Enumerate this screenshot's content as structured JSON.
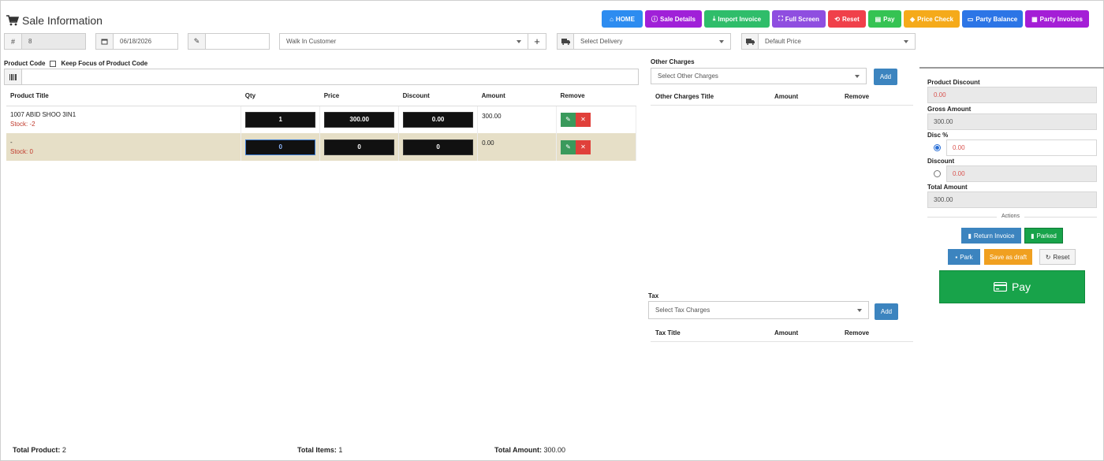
{
  "header": {
    "title": "Sale Information"
  },
  "toolbar": [
    {
      "label": "HOME",
      "icon": "home-icon",
      "color": "#2d8cf0",
      "w": 52
    },
    {
      "label": "Sale Details",
      "icon": "info-icon",
      "color": "#a020d8",
      "w": 72
    },
    {
      "label": "Import Invoice",
      "icon": "download-icon",
      "color": "#2fbd6a",
      "w": 83
    },
    {
      "label": "Full Screen",
      "icon": "fullscreen-icon",
      "color": "#8f4ee0",
      "w": 68
    },
    {
      "label": "Reset",
      "icon": "reset-icon",
      "color": "#f0404a",
      "w": 48
    },
    {
      "label": "Pay",
      "icon": "pay-icon",
      "color": "#35c353",
      "w": 42
    },
    {
      "label": "Price Check",
      "icon": "tag-icon",
      "color": "#f5aa1a",
      "w": 71
    },
    {
      "label": "Party Balance",
      "icon": "wallet-icon",
      "color": "#2c75e6",
      "w": 77
    },
    {
      "label": "Party Invoices",
      "icon": "invoice-icon",
      "color": "#a41ed6",
      "w": 81
    }
  ],
  "form": {
    "invoice_no": "8",
    "date": "06/18/2026",
    "note": "",
    "customer": "Walk In Customer",
    "delivery": "Select Delivery",
    "price_type": "Default Price"
  },
  "product_code": {
    "label": "Product Code",
    "keep_focus_label": "Keep Focus of Product Code",
    "value": ""
  },
  "table": {
    "headers": [
      "Product Title",
      "Qty",
      "Price",
      "Discount",
      "Amount",
      "Remove"
    ],
    "rows": [
      {
        "title": "1007 ABID SHOO 3IN1",
        "stock": "Stock: -2",
        "qty": "1",
        "price": "300.00",
        "discount": "0.00",
        "amount": "300.00"
      },
      {
        "title": "-",
        "stock": "Stock: 0",
        "qty": "0",
        "price": "0",
        "discount": "0",
        "amount": "0.00"
      }
    ]
  },
  "other_charges": {
    "label": "Other Charges",
    "placeholder": "Select Other Charges",
    "add_label": "Add",
    "headers": [
      "Other Charges Title",
      "Amount",
      "Remove"
    ]
  },
  "tax": {
    "label": "Tax",
    "placeholder": "Select Tax Charges",
    "add_label": "Add",
    "headers": [
      "Tax Title",
      "Amount",
      "Remove"
    ]
  },
  "summary": {
    "product_discount_label": "Product Discount",
    "product_discount": "0.00",
    "gross_amount_label": "Gross Amount",
    "gross_amount": "300.00",
    "disc_pct_label": "Disc %",
    "disc_pct": "0.00",
    "discount_label": "Discount",
    "discount": "0.00",
    "total_amount_label": "Total Amount",
    "total_amount": "300.00",
    "actions_label": "Actions"
  },
  "actions": {
    "return_invoice": "Return Invoice",
    "parked": "Parked",
    "park": "Park",
    "save_draft": "Save as draft",
    "reset": "Reset",
    "pay": "Pay"
  },
  "footer": {
    "total_product_label": "Total Product:",
    "total_product": "2",
    "total_items_label": "Total Items:",
    "total_items": "1",
    "total_amount_label": "Total Amount:",
    "total_amount": "300.00"
  },
  "colors": {
    "selected_row": "#e6dfc7",
    "edit_green": "#3a9a5c",
    "remove_red": "#e0403a",
    "pay_green": "#18a34a",
    "save_orange": "#f0a020",
    "add_blue": "#3c84bf",
    "discount_red": "#d9534f"
  }
}
